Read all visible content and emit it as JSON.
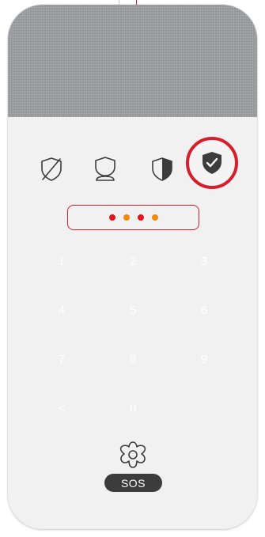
{
  "modes": [
    {
      "icon": "shield-slash-icon",
      "state": "inactive"
    },
    {
      "icon": "shield-night-icon",
      "state": "inactive"
    },
    {
      "icon": "shield-half-icon",
      "state": "inactive"
    },
    {
      "icon": "shield-check-icon",
      "state": "selected"
    }
  ],
  "pin_dots": {
    "count": 4,
    "colors": [
      "#e3161e",
      "#f08a12",
      "#e3161e",
      "#f08a12"
    ]
  },
  "keypad": {
    "keys": [
      "1",
      "2",
      "3",
      "4",
      "5",
      "6",
      "7",
      "8",
      "9",
      "<",
      "0"
    ]
  },
  "sos": {
    "label": "SOS",
    "icon": "flower-icon"
  },
  "colors": {
    "accent": "#d71e2c",
    "body": "#f1f1f1",
    "fabric": "#9fa1a3",
    "icon": "#3c3c3c",
    "key_text": "#ffffff"
  }
}
